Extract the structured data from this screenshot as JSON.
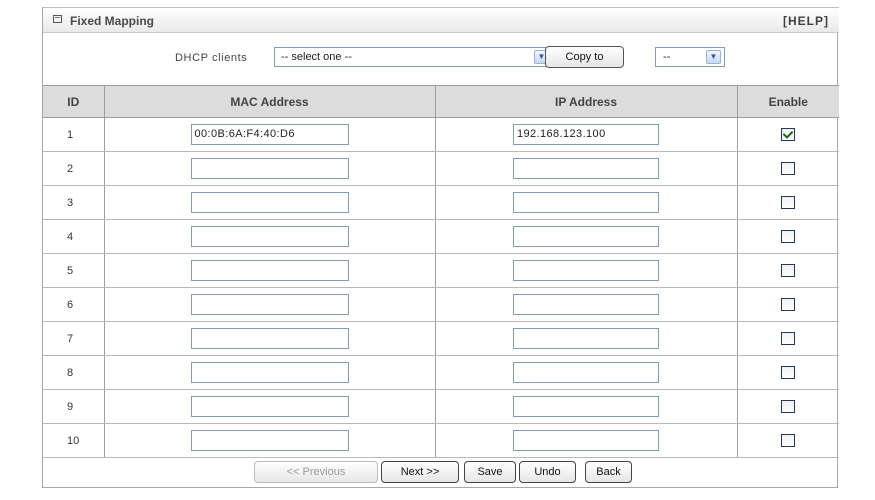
{
  "title": "Fixed Mapping",
  "help": "[HELP]",
  "dhcp": {
    "label": "DHCP clients",
    "select_value": "-- select one --",
    "copy_button": "Copy to",
    "target_value": "--"
  },
  "columns": [
    "ID",
    "MAC Address",
    "IP Address",
    "Enable"
  ],
  "rows": [
    {
      "id": "1",
      "mac": "00:0B:6A:F4:40:D6",
      "ip": "192.168.123.100",
      "enabled": true
    },
    {
      "id": "2",
      "mac": "",
      "ip": "",
      "enabled": false
    },
    {
      "id": "3",
      "mac": "",
      "ip": "",
      "enabled": false
    },
    {
      "id": "4",
      "mac": "",
      "ip": "",
      "enabled": false
    },
    {
      "id": "5",
      "mac": "",
      "ip": "",
      "enabled": false
    },
    {
      "id": "6",
      "mac": "",
      "ip": "",
      "enabled": false
    },
    {
      "id": "7",
      "mac": "",
      "ip": "",
      "enabled": false
    },
    {
      "id": "8",
      "mac": "",
      "ip": "",
      "enabled": false
    },
    {
      "id": "9",
      "mac": "",
      "ip": "",
      "enabled": false
    },
    {
      "id": "10",
      "mac": "",
      "ip": "",
      "enabled": false
    }
  ],
  "buttons": {
    "previous": "<< Previous",
    "next": "Next >>",
    "save": "Save",
    "undo": "Undo",
    "back": "Back"
  }
}
